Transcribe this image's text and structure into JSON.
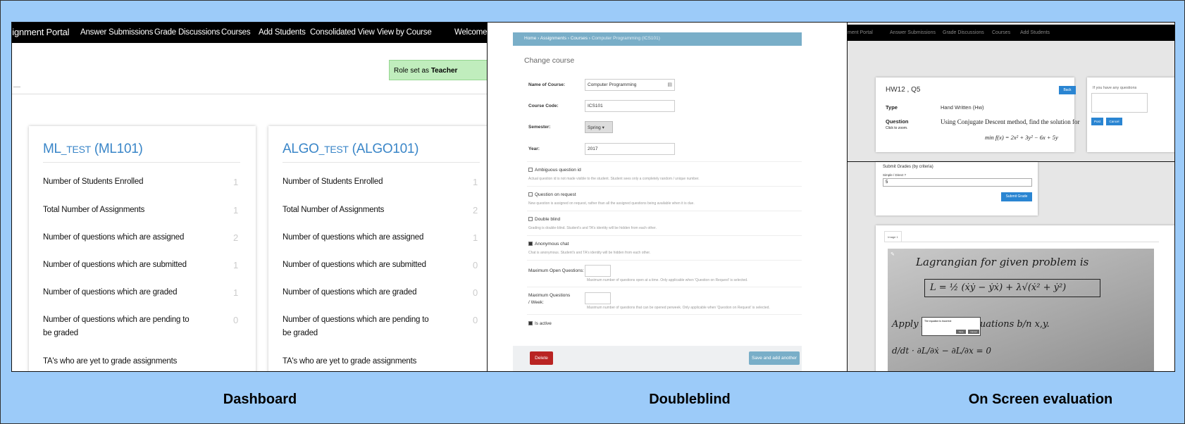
{
  "dashboard": {
    "nav": [
      "signment Portal",
      "Answer Submissions",
      "Grade Discussions",
      "Courses",
      "Add Students",
      "Consolidated View",
      "View by Course",
      "Welcome"
    ],
    "role_prefix": "Role set as",
    "role_value": "Teacher",
    "courses": [
      {
        "name": "ML",
        "suffix": "_TEST",
        "code": "(ML101)",
        "rows": [
          {
            "label": "Number of Students Enrolled",
            "value": "1"
          },
          {
            "label": "Total Number of Assignments",
            "value": "1"
          },
          {
            "label": "Number of questions which are assigned",
            "value": "2"
          },
          {
            "label": "Number of questions which are submitted",
            "value": "1"
          },
          {
            "label": "Number of questions which are graded",
            "value": "1"
          },
          {
            "label": "Number of questions which are pending to be graded",
            "value": "0"
          },
          {
            "label": "TA's who are yet to grade assignments",
            "value": ""
          }
        ]
      },
      {
        "name": "ALGO",
        "suffix": "_TEST",
        "code": "(ALGO101)",
        "rows": [
          {
            "label": "Number of Students Enrolled",
            "value": "1"
          },
          {
            "label": "Total Number of Assignments",
            "value": "2"
          },
          {
            "label": "Number of questions which are assigned",
            "value": "1"
          },
          {
            "label": "Number of questions which are submitted",
            "value": "0"
          },
          {
            "label": "Number of questions which are graded",
            "value": "0"
          },
          {
            "label": "Number of questions which are pending to be graded",
            "value": "0"
          },
          {
            "label": "TA's who are yet to grade assignments",
            "value": ""
          }
        ]
      }
    ]
  },
  "doubleblind": {
    "breadcrumb": "Home › Assignments › Courses ›",
    "breadcrumb_current": "Computer Programming (ICS101)",
    "heading": "Change course",
    "fields": {
      "name_label": "Name of Course:",
      "name_value": "Computer Programming",
      "code_label": "Course Code:",
      "code_value": "ICS101",
      "semester_label": "Semester:",
      "semester_value": "Spring ▾",
      "year_label": "Year:",
      "year_value": "2017"
    },
    "checks": [
      {
        "label": "Ambiguous question id",
        "checked": false,
        "help": "Actual question id is not made visible to the student. Student sees only a completely random / unique number."
      },
      {
        "label": "Question on request",
        "checked": false,
        "help": "New question is assigned on request, rather than all the assigned questions being available when it is due."
      },
      {
        "label": "Double blind",
        "checked": false,
        "help": "Grading is double-blind. Student's and TA's identity will be hidden from each other."
      },
      {
        "label": "Anonymous chat",
        "checked": true,
        "help": "Chat is anonymous. Student's and TA's identity will be hidden from each other."
      }
    ],
    "max_open_label": "Maximum Open Questions:",
    "max_open_help": "Maximum number of questions open at a time. Only applicable when 'Question on Request' is selected.",
    "max_week_label": "Maximum Questions / Week:",
    "max_week_help": "Maximum number of questions that can be opened perweek. Only applicable when 'Question on Request' is selected.",
    "is_active_label": "Is active",
    "is_active_checked": true,
    "delete_label": "Delete",
    "save_another_label": "Save and add another"
  },
  "evaluation": {
    "nav": [
      "ment Portal",
      "Answer Submissions",
      "Grade Discussions",
      "Courses",
      "Add Students"
    ],
    "question_title": "HW12 , Q5",
    "back_label": "Back",
    "type_key": "Type",
    "type_value": "Hand Written (Hw)",
    "question_key": "Question",
    "question_sub": "Click to zoom.",
    "question_text": "Using Conjugate Descent method, find the solution for",
    "question_eq": "min f(x) = 2x² + 3y² − 6x + 5y",
    "side_prompt": "If you have any questions",
    "post_label": "Post",
    "cancel_label": "Cancel",
    "grades_title": "Submit Grades (by criteria)",
    "simple_label": "Simple / Direct ?",
    "grade_value": "5",
    "submit_label": "Submit Grade",
    "image_tab": "Image 1",
    "hw_line1": "Lagrangian for given problem is",
    "hw_eq": "L = ½ (ẋẏ − ẏẋ) + λ√(ẋ² + ẏ²)",
    "hw_line2": "Apply Lagrange equations b/n x,y.",
    "hw_line3": "d/dt · ∂L/∂ẋ − ∂L/∂x = 0",
    "dialog_text": "The equation is incorrect",
    "dialog_ok": "Save",
    "dialog_cancel": "Cancel"
  },
  "captions": {
    "left": "Dashboard",
    "middle": "Doubleblind",
    "right": "On Screen evaluation"
  },
  "colors": {
    "background": "#9ccbf9",
    "link_blue": "#3a86c8",
    "admin_blue": "#79aec8",
    "danger_red": "#b92423",
    "success_green": "#c0edbd"
  }
}
